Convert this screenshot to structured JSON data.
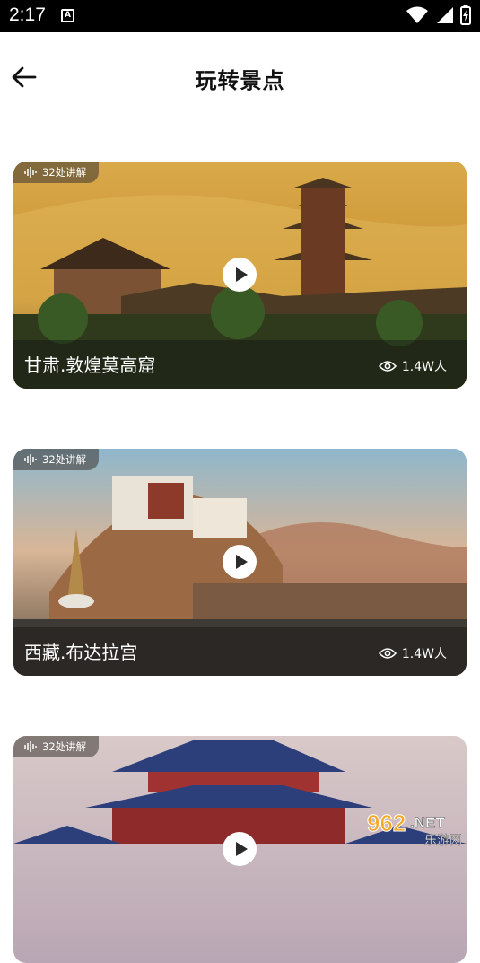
{
  "status_bar": {
    "time": "2:17",
    "notification_glyph": "A"
  },
  "header": {
    "title": "玩转景点",
    "back_icon": "arrow-left-icon"
  },
  "cards": [
    {
      "badge": "32处讲解",
      "name": "甘肃.敦煌莫高窟",
      "views": "1.4W人"
    },
    {
      "badge": "32处讲解",
      "name": "西藏.布达拉宫",
      "views": "1.4W人"
    },
    {
      "badge": "32处讲解",
      "name": "",
      "views": ""
    }
  ],
  "watermark": {
    "main": "962",
    "suffix": ".NET",
    "sub": "乐游网"
  }
}
